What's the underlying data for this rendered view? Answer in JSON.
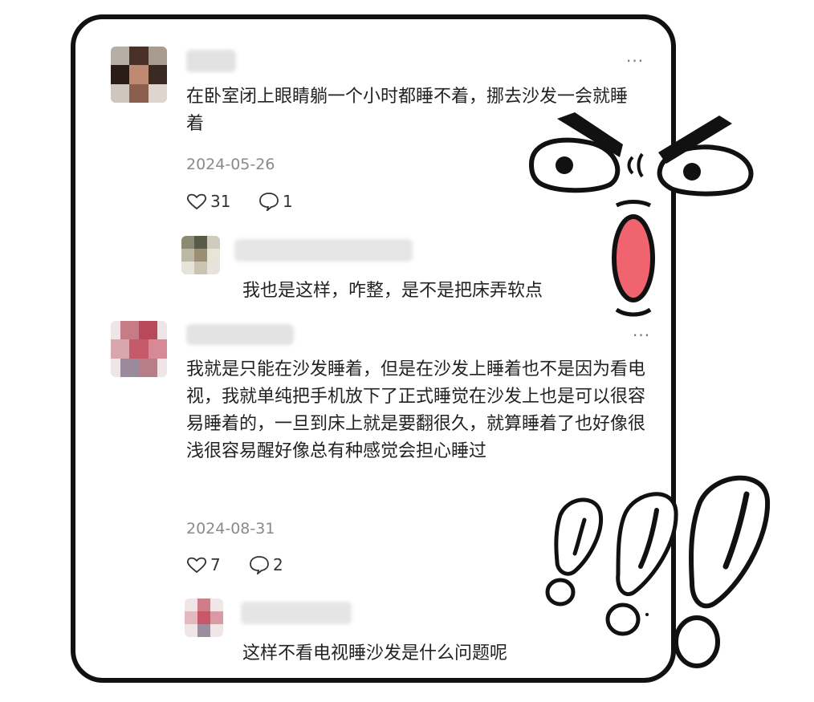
{
  "comments": [
    {
      "text": "在卧室闭上眼睛躺一个小时都睡不着，挪去沙发一会就睡着",
      "date": "2024-05-26",
      "likes": "31",
      "replies": "1",
      "more": "···",
      "reply": {
        "text": "我也是这样，咋整，是不是把床弄软点"
      }
    },
    {
      "text": "我就是只能在沙发睡着，但是在沙发上睡着也不是因为看电视，我就单纯把手机放下了正式睡觉在沙发上也是可以很容易睡着的，一旦到床上就是要翻很久，就算睡着了也好像很浅很容易醒好像总有种感觉会担心睡过",
      "date": "2024-08-31",
      "likes": "7",
      "replies": "2",
      "more": "···",
      "reply": {
        "text": "这样不看电视睡沙发是什么问题呢"
      }
    }
  ],
  "icons": {
    "like": "heart-outline-icon",
    "reply": "speech-bubble-icon",
    "more": "more-dots-icon"
  },
  "colors": {
    "accent_mouth": "#f06470",
    "border": "#111111",
    "date_gray": "#8a8a8a"
  }
}
